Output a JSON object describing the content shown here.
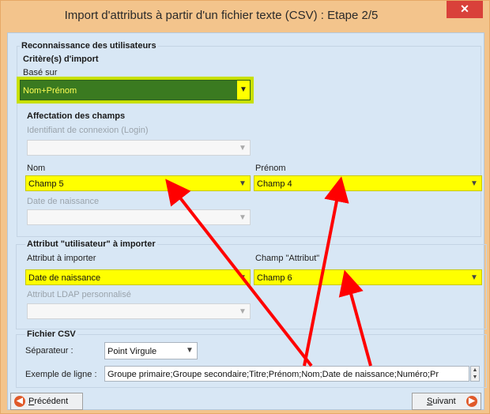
{
  "window": {
    "title": "Import d'attributs à partir d'un fichier texte (CSV) : Etape 2/5",
    "close_glyph": "✕"
  },
  "users_section": {
    "title": "Reconnaissance des utilisateurs"
  },
  "criteria": {
    "title": "Critère(s) d'import",
    "based_on_label": "Basé sur",
    "based_on_value": "Nom+Prénom"
  },
  "fields": {
    "title": "Affectation des champs",
    "login_label": "Identifiant de connexion (Login)",
    "login_value": "",
    "nom_label": "Nom",
    "nom_value": "Champ 5",
    "prenom_label": "Prénom",
    "prenom_value": "Champ 4",
    "birth_label": "Date de naissance",
    "birth_value": ""
  },
  "user_attribute": {
    "title": "Attribut \"utilisateur\" à importer",
    "attr_label": "Attribut à importer",
    "attr_value": "Date de naissance",
    "field_label": "Champ \"Attribut\"",
    "field_value": "Champ 6",
    "ldap_label": "Attribut LDAP personnalisé",
    "ldap_value": ""
  },
  "csv": {
    "title": "Fichier CSV",
    "separator_label": "Séparateur :",
    "separator_value": "Point Virgule",
    "sample_label": "Exemple de ligne :",
    "sample_value": "Groupe primaire;Groupe secondaire;Titre;Prénom;Nom;Date de naissance;Numéro;Pr"
  },
  "footer": {
    "prev_first": "P",
    "prev_rest": "récédent",
    "next_first": "S",
    "next_rest": "uivant"
  },
  "colors": {
    "highlight": "#ffff00",
    "arrow": "#ff0000",
    "selected_green": "#3a7a20"
  }
}
